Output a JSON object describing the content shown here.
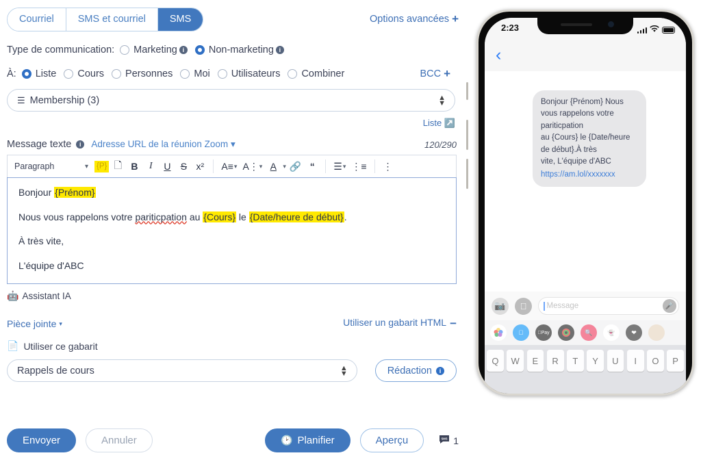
{
  "tabs": [
    {
      "label": "Courriel",
      "active": false
    },
    {
      "label": "SMS et courriel",
      "active": false
    },
    {
      "label": "SMS",
      "active": true
    }
  ],
  "advanced_options": {
    "label": "Options avancées",
    "icon": "plus-icon"
  },
  "communication_type": {
    "label": "Type de communication:",
    "options": [
      {
        "label": "Marketing",
        "selected": false,
        "has_info": true
      },
      {
        "label": "Non-marketing",
        "selected": true,
        "has_info": true
      }
    ]
  },
  "recipients": {
    "label": "À:",
    "options": [
      {
        "label": "Liste",
        "selected": true
      },
      {
        "label": "Cours",
        "selected": false
      },
      {
        "label": "Personnes",
        "selected": false
      },
      {
        "label": "Moi",
        "selected": false
      },
      {
        "label": "Utilisateurs",
        "selected": false
      },
      {
        "label": "Combiner",
        "selected": false
      }
    ],
    "bcc_label": "BCC"
  },
  "list_select": {
    "value": "Membership (3)",
    "icon": "list-icon",
    "link_label": "Liste",
    "link_icon": "external-link-icon"
  },
  "message": {
    "label": "Message texte",
    "zoom_link": "Adresse URL de la réunion Zoom",
    "char_count": "120/290",
    "toolbar": {
      "block_format": "Paragraph",
      "merge_field": "{P}",
      "buttons": [
        "template-icon",
        "bold-icon",
        "italic-icon",
        "underline-icon",
        "strikethrough-icon",
        "superscript-icon",
        "font-size-icon",
        "line-height-icon",
        "text-color-icon",
        "link-icon",
        "quote-icon",
        "align-icon",
        "bullet-list-icon",
        "more-options-icon"
      ]
    },
    "body": {
      "line1_prefix": "Bonjour ",
      "line1_field": "{Prénom}",
      "line2_prefix": "Nous vous rappelons votre ",
      "line2_misspelled": "pariticpation",
      "line2_mid": " au ",
      "line2_field1": "{Cours}",
      "line2_sep": " le ",
      "line2_field2": "{Date/heure de début}",
      "line2_suffix": ".",
      "line3": "À très vite,",
      "line4": "L'équipe d'ABC"
    }
  },
  "ai_assistant": {
    "label": "Assistant IA",
    "icon": "robot-icon"
  },
  "attachment": {
    "label": "Pièce jointe",
    "icon": "caret-down-icon"
  },
  "html_template_toggle": {
    "label": "Utiliser un gabarit HTML",
    "icon": "minus-icon"
  },
  "use_template": {
    "label": "Utiliser ce gabarit",
    "icon": "document-icon"
  },
  "template_select": {
    "value": "Rappels de cours"
  },
  "redaction_button": {
    "label": "Rédaction",
    "has_info": true
  },
  "footer": {
    "send_label": "Envoyer",
    "cancel_label": "Annuler",
    "schedule_label": "Planifier",
    "schedule_icon": "clock-icon",
    "preview_label": "Aperçu",
    "sms_count": "1",
    "sms_count_icon": "sms-bubble-icon"
  },
  "phone": {
    "status": {
      "time": "2:23",
      "signal_icon": "signal-bars-icon",
      "wifi_icon": "wifi-icon",
      "battery_icon": "battery-icon"
    },
    "nav": {
      "back_icon": "back-chevron-icon"
    },
    "sms_bubble": {
      "lines": [
        "Bonjour {Prénom} Nous",
        "vous rappelons votre",
        "pariticpation",
        "au {Cours} le {Date/heure",
        "de début}.À très",
        "vite, L'équipe d'ABC"
      ],
      "link": "https://am.lol/xxxxxxx"
    },
    "input_bar": {
      "camera_icon": "camera-icon",
      "appstore_icon": "app-store-icon",
      "placeholder": "Message",
      "mic_icon": "microphone-icon"
    },
    "app_strip": [
      "photos-icon",
      "app-store-icon",
      "apple-pay-icon",
      "music-icon",
      "search-icon",
      "memoji-icon",
      "digital-touch-icon"
    ],
    "keyboard_row": [
      "Q",
      "W",
      "E",
      "R",
      "T",
      "Y",
      "U",
      "I",
      "O",
      "P"
    ]
  },
  "colors": {
    "accent_blue": "#4178be",
    "link_blue": "#3d6fb5",
    "highlight_yellow": "#ffe900",
    "editor_border": "#8fa9d8",
    "text_dark": "#3c4257"
  }
}
